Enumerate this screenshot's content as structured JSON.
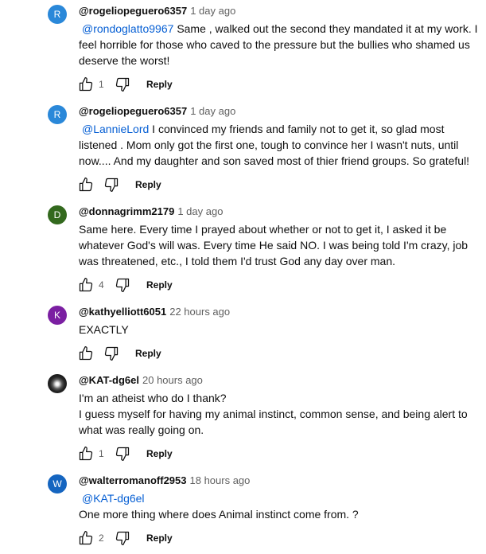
{
  "comments": [
    {
      "avatar_letter": "R",
      "avatar_color": "#2a88d9",
      "author": "@rogeliopeguero6357",
      "time": "1 day ago",
      "mention": "@rondoglatto9967",
      "lines": [
        "Same , walked out the second they mandated it at my work. I",
        "feel horrible for those who caved to the pressure but the bullies who shamed us",
        "deserve the worst!"
      ],
      "likes": "1",
      "reply_label": "Reply"
    },
    {
      "avatar_letter": "R",
      "avatar_color": "#2a88d9",
      "author": "@rogeliopeguero6357",
      "time": "1 day ago",
      "mention": "@LannieLord",
      "lines": [
        "I convinced my friends and family not to get it, so glad most",
        "listened . Mom only got the first one, tough to convince her I wasn't nuts, until",
        "now.... And my daughter and son saved most of thier friend groups. So grateful!"
      ],
      "likes": "",
      "reply_label": "Reply"
    },
    {
      "avatar_letter": "D",
      "avatar_color": "#33691e",
      "author": "@donnagrimm2179",
      "time": "1 day ago",
      "lines": [
        "Same here. Every time I prayed about whether or not to get it, I asked it be",
        "whatever God's will was. Every time He said NO. I was being told I'm crazy, job",
        "was threatened, etc., I told them I'd trust God any day over man."
      ],
      "likes": "4",
      "reply_label": "Reply"
    },
    {
      "avatar_letter": "K",
      "avatar_color": "#7b1fa2",
      "author": "@kathyelliott6051",
      "time": "22 hours ago",
      "lines": [
        "EXACTLY"
      ],
      "likes": "",
      "reply_label": "Reply"
    },
    {
      "avatar_letter": "",
      "avatar_color": "#1a1a1a",
      "author": "@KAT-dg6el",
      "time": "20 hours ago",
      "lines": [
        "I'm an atheist who do I thank?",
        "I guess myself for having my animal instinct, common sense, and being alert to",
        "what was really going on."
      ],
      "likes": "1",
      "reply_label": "Reply"
    },
    {
      "avatar_letter": "W",
      "avatar_color": "#1565c0",
      "author": "@walterromanoff2953",
      "time": "18 hours ago",
      "mention_line": "@KAT-dg6el",
      "lines": [
        "One more thing where does Animal instinct come from. ?"
      ],
      "likes": "2",
      "reply_label": "Reply"
    }
  ]
}
